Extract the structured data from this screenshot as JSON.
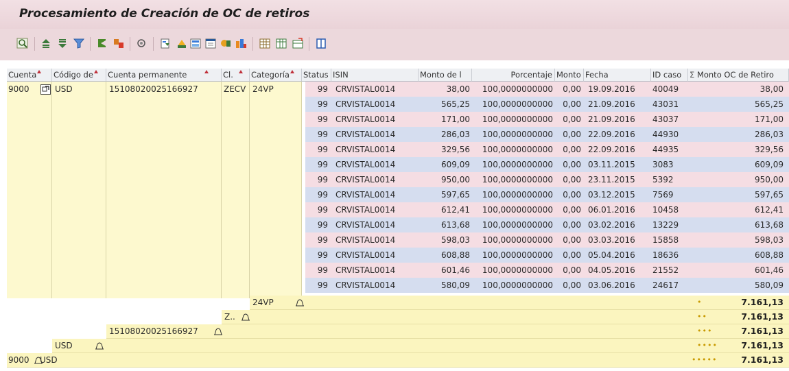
{
  "title": "Procesamiento de Creación de OC de retiros",
  "toolbar": {
    "icons": [
      "details-icon",
      "ascending-sort-icon",
      "descending-sort-icon",
      "filter-icon",
      "subtotal-icon",
      "total-icon",
      "print-preview-icon",
      "export-icon",
      "spreadsheet-icon",
      "word-processing-icon",
      "local-file-icon",
      "mail-icon",
      "abc-analysis-icon",
      "graphic-icon",
      "layout-icon",
      "choose-layout-icon",
      "save-layout-icon",
      "info-icon"
    ]
  },
  "columns": {
    "cuenta": "Cuenta",
    "codigo": "Código de",
    "cuenta_perm": "Cuenta permanente",
    "cl": "Cl.",
    "categoria": "Categoría",
    "status": "Status",
    "isin": "ISIN",
    "monto_de": "Monto de l",
    "porcentaje": "Porcentaje",
    "monto": "Monto",
    "fecha": "Fecha",
    "id_caso": "ID caso",
    "sum_marker": "Σ",
    "monto_oc": "Monto OC de Retiro"
  },
  "group": {
    "cuenta": "9000",
    "codigo": "USD",
    "cuenta_perm": "15108020025166927",
    "cl": "ZECV",
    "categoria": "24VP"
  },
  "rows": [
    {
      "status": "99",
      "isin": "CRVISTAL0014",
      "monto_de": "38,00",
      "porcentaje": "100,0000000000",
      "monto": "0,00",
      "fecha": "19.09.2016",
      "id_caso": "40049",
      "monto_oc": "38,00"
    },
    {
      "status": "99",
      "isin": "CRVISTAL0014",
      "monto_de": "565,25",
      "porcentaje": "100,0000000000",
      "monto": "0,00",
      "fecha": "21.09.2016",
      "id_caso": "43031",
      "monto_oc": "565,25"
    },
    {
      "status": "99",
      "isin": "CRVISTAL0014",
      "monto_de": "171,00",
      "porcentaje": "100,0000000000",
      "monto": "0,00",
      "fecha": "21.09.2016",
      "id_caso": "43037",
      "monto_oc": "171,00"
    },
    {
      "status": "99",
      "isin": "CRVISTAL0014",
      "monto_de": "286,03",
      "porcentaje": "100,0000000000",
      "monto": "0,00",
      "fecha": "22.09.2016",
      "id_caso": "44930",
      "monto_oc": "286,03"
    },
    {
      "status": "99",
      "isin": "CRVISTAL0014",
      "monto_de": "329,56",
      "porcentaje": "100,0000000000",
      "monto": "0,00",
      "fecha": "22.09.2016",
      "id_caso": "44935",
      "monto_oc": "329,56"
    },
    {
      "status": "99",
      "isin": "CRVISTAL0014",
      "monto_de": "609,09",
      "porcentaje": "100,0000000000",
      "monto": "0,00",
      "fecha": "03.11.2015",
      "id_caso": "3083",
      "monto_oc": "609,09"
    },
    {
      "status": "99",
      "isin": "CRVISTAL0014",
      "monto_de": "950,00",
      "porcentaje": "100,0000000000",
      "monto": "0,00",
      "fecha": "23.11.2015",
      "id_caso": "5392",
      "monto_oc": "950,00"
    },
    {
      "status": "99",
      "isin": "CRVISTAL0014",
      "monto_de": "597,65",
      "porcentaje": "100,0000000000",
      "monto": "0,00",
      "fecha": "03.12.2015",
      "id_caso": "7569",
      "monto_oc": "597,65"
    },
    {
      "status": "99",
      "isin": "CRVISTAL0014",
      "monto_de": "612,41",
      "porcentaje": "100,0000000000",
      "monto": "0,00",
      "fecha": "06.01.2016",
      "id_caso": "10458",
      "monto_oc": "612,41"
    },
    {
      "status": "99",
      "isin": "CRVISTAL0014",
      "monto_de": "613,68",
      "porcentaje": "100,0000000000",
      "monto": "0,00",
      "fecha": "03.02.2016",
      "id_caso": "13229",
      "monto_oc": "613,68"
    },
    {
      "status": "99",
      "isin": "CRVISTAL0014",
      "monto_de": "598,03",
      "porcentaje": "100,0000000000",
      "monto": "0,00",
      "fecha": "03.03.2016",
      "id_caso": "15858",
      "monto_oc": "598,03"
    },
    {
      "status": "99",
      "isin": "CRVISTAL0014",
      "monto_de": "608,88",
      "porcentaje": "100,0000000000",
      "monto": "0,00",
      "fecha": "05.04.2016",
      "id_caso": "18636",
      "monto_oc": "608,88"
    },
    {
      "status": "99",
      "isin": "CRVISTAL0014",
      "monto_de": "601,46",
      "porcentaje": "100,0000000000",
      "monto": "0,00",
      "fecha": "04.05.2016",
      "id_caso": "21552",
      "monto_oc": "601,46"
    },
    {
      "status": "99",
      "isin": "CRVISTAL0014",
      "monto_de": "580,09",
      "porcentaje": "100,0000000000",
      "monto": "0,00",
      "fecha": "03.06.2016",
      "id_caso": "24617",
      "monto_oc": "580,09"
    }
  ],
  "subtotals": [
    {
      "label": "24VP",
      "dots": "•",
      "value": "7.161,13"
    },
    {
      "label": "Z..",
      "dots": "••",
      "value": "7.161,13"
    },
    {
      "label": "15108020025166927",
      "dots": "•••",
      "value": "7.161,13"
    },
    {
      "label": "USD",
      "dots": "••••",
      "value": "7.161,13"
    },
    {
      "label": "9000",
      "label2": "USD",
      "dots": "•••••",
      "value": "7.161,13"
    }
  ],
  "colors": {
    "pink_row": "#f5dde3",
    "blue_row": "#d5ddef",
    "yellow": "#fdf9cf",
    "total_yellow": "#fbf5bf"
  }
}
